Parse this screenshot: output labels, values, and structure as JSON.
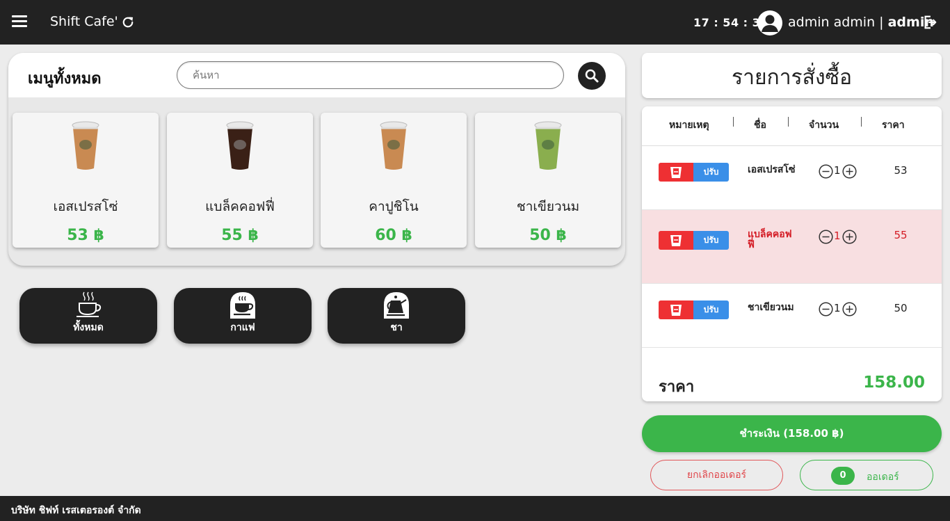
{
  "header": {
    "app_title": "Shift Cafe'",
    "clock": "17 : 54 : 31",
    "user_name": "admin admin",
    "user_separator": " | ",
    "user_role": "admin"
  },
  "menu": {
    "title": "เมนูทั้งหมด",
    "search_placeholder": "ค้นหา",
    "products": [
      {
        "name": "เอสเปรสโซ่",
        "price": "53 ฿",
        "drink_color": "#c98a52"
      },
      {
        "name": "แบล็คคอฟฟี่",
        "price": "55 ฿",
        "drink_color": "#3a2016"
      },
      {
        "name": "คาปูชิโน",
        "price": "60 ฿",
        "drink_color": "#c98a52"
      },
      {
        "name": "ชาเขียวนม",
        "price": "50 ฿",
        "drink_color": "#8aae4e"
      }
    ]
  },
  "categories": [
    {
      "label": "ทั้งหมด",
      "icon": "coffee-cup-icon"
    },
    {
      "label": "กาแฟ",
      "icon": "coffee-icon"
    },
    {
      "label": "ชา",
      "icon": "teapot-icon"
    }
  ],
  "order": {
    "title": "รายการสั่งซื้อ",
    "columns": [
      "หมายเหตุ",
      "ชื่อ",
      "จำนวน",
      "ราคา"
    ],
    "adjust_label": "ปรับ",
    "items": [
      {
        "name": "เอสเปรสโซ่",
        "qty": "1",
        "price": "53",
        "highlighted": false
      },
      {
        "name": "แบล็คคอฟฟี่",
        "qty": "1",
        "price": "55",
        "highlighted": true
      },
      {
        "name": "ชาเขียวนม",
        "qty": "1",
        "price": "50",
        "highlighted": false
      }
    ],
    "total_label": "ราคา",
    "total_value": "158.00",
    "pay_label": "ชำระเงิน (158.00 ฿)",
    "cancel_label": "ยกเลิกออเดอร์",
    "orders_count": "0",
    "orders_label": "ออเดอร์"
  },
  "footer": {
    "company": "บริษัท ชิฟท์ เรสเตอรองต์ จำกัด"
  },
  "colors": {
    "accent_green": "#3bb54a",
    "danger_red": "#ee3033",
    "adjust_blue": "#3a8fe8",
    "dark": "#222222"
  }
}
